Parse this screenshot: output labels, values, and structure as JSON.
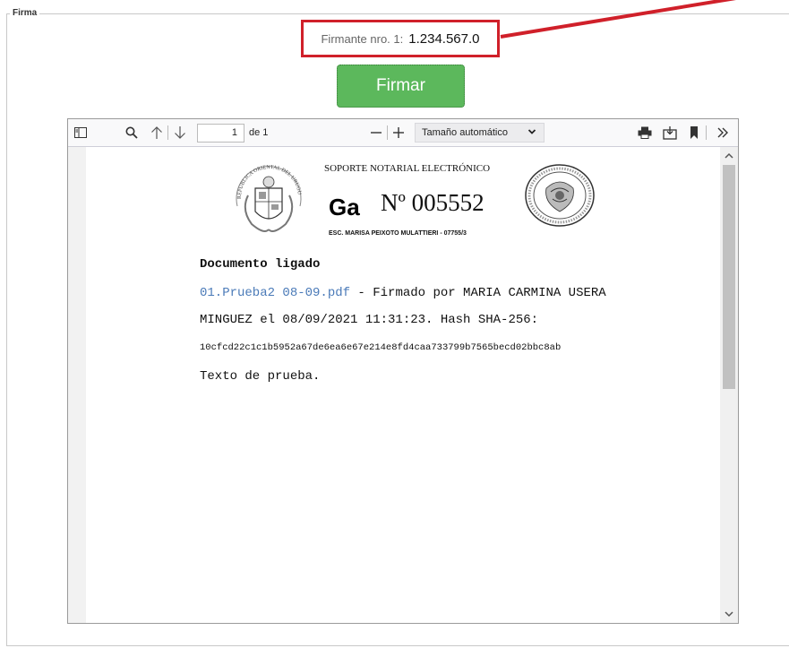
{
  "fieldset": {
    "legend": "Firma"
  },
  "firmante": {
    "label": "Firmante nro. 1:",
    "value": "1.234.567.0"
  },
  "firmar_button": {
    "label": "Firmar"
  },
  "viewer_toolbar": {
    "page_number": "1",
    "page_of": "de 1",
    "zoom_value": "Tamaño automático",
    "icons": [
      "sidebar-toggle-icon",
      "search-icon",
      "arrow-up-icon",
      "arrow-down-icon",
      "zoom-out-icon",
      "zoom-in-icon",
      "print-icon",
      "download-icon",
      "bookmark-icon",
      "more-tools-icon"
    ]
  },
  "document": {
    "header_title": "SOPORTE NOTARIAL ELECTRÓNICO",
    "series": "Ga",
    "number": "Nº 005552",
    "notary": "ESC. MARISA PEIXOTO MULATTIERI - 07755/3",
    "seal_text": "REPUBLICA ORIENTAL DEL URUGUAY",
    "heading": "Documento ligado",
    "link_text": "01.Prueba2 08-09.pdf",
    "line1_rest": " - Firmado por MARIA CARMINA USERA",
    "line2": "MINGUEZ el 08/09/2021 11:31:23. Hash SHA-256:",
    "hash": "10cfcd22c1c1b5952a67de6ea6e67e214e8fd4caa733799b7565becd02bbc8ab",
    "body_text": "Texto de prueba."
  },
  "colors": {
    "highlight": "#d0202a",
    "button_green": "#5cb85c",
    "link": "#4a7ab8"
  }
}
